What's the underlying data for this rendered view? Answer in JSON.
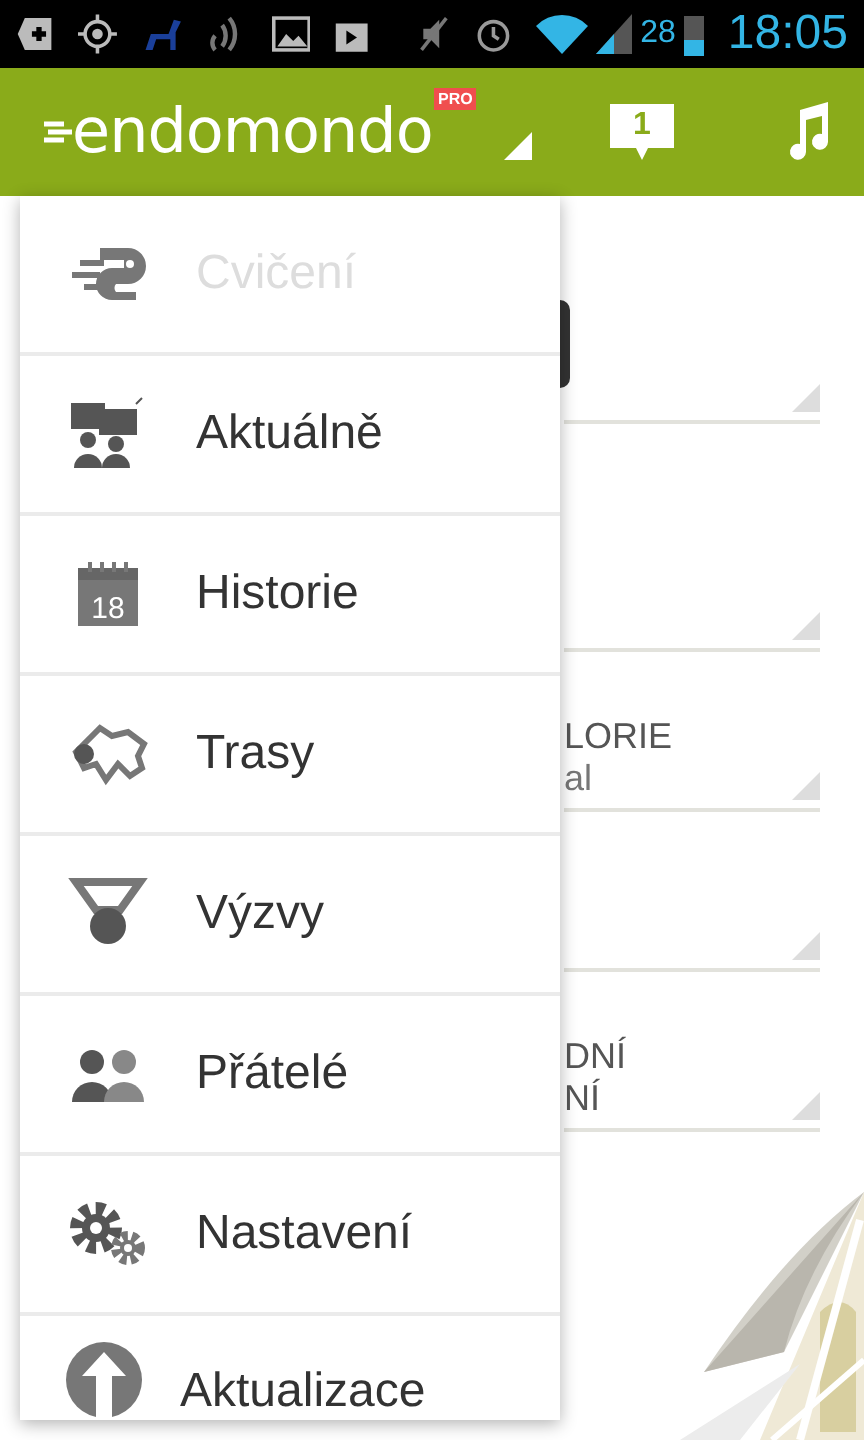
{
  "status_bar": {
    "battery_percent": "28",
    "time": "18:05"
  },
  "app_bar": {
    "logo": "endomondo",
    "badge": "PRO",
    "notification_count": "1"
  },
  "form": {
    "fields": [
      {
        "kind": "dropdown"
      },
      {
        "kind": "dropdown"
      },
      {
        "kind": "dropdown",
        "label": "LORIE",
        "value": "al"
      },
      {
        "kind": "dropdown"
      },
      {
        "kind": "dropdown",
        "label": "DNÍ",
        "value": "NÍ"
      }
    ]
  },
  "menu": {
    "items": [
      {
        "label": "Cvičení",
        "disabled": true
      },
      {
        "label": "Aktuálně",
        "disabled": false
      },
      {
        "label": "Historie",
        "disabled": false,
        "icon_text": "18"
      },
      {
        "label": "Trasy",
        "disabled": false
      },
      {
        "label": "Výzvy",
        "disabled": false
      },
      {
        "label": "Přátelé",
        "disabled": false
      },
      {
        "label": "Nastavení",
        "disabled": false
      },
      {
        "label": "Aktualizace",
        "disabled": false
      }
    ]
  }
}
